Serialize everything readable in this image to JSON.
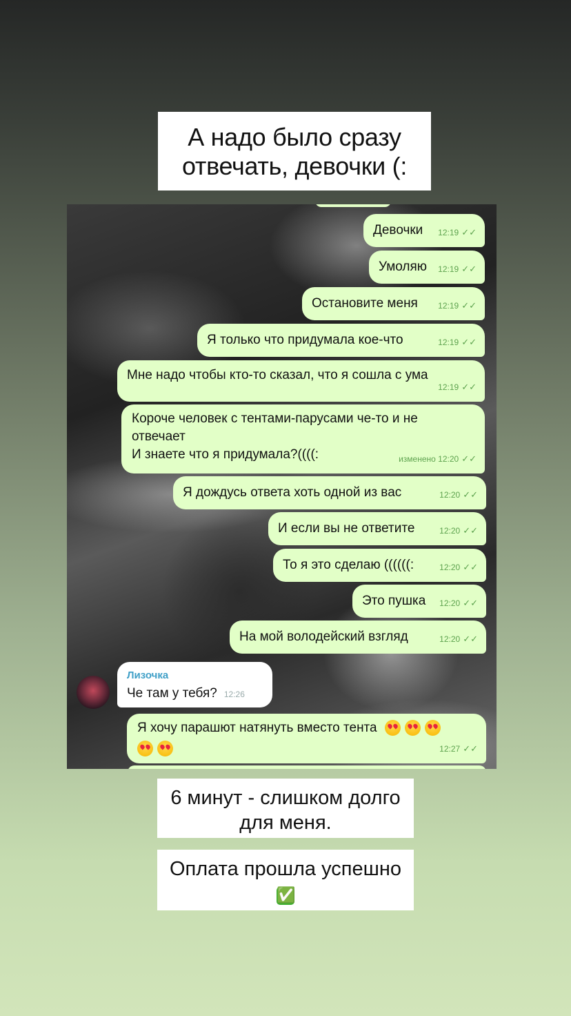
{
  "captions": {
    "top": [
      "А надо было сразу",
      "отвечать, девочки (:"
    ],
    "middle": [
      "6 минут - слишком долго",
      "для меня."
    ],
    "bottom": "Оплата прошла успешно",
    "bottom_emoji": "✅"
  },
  "chat": {
    "outgoing": [
      {
        "text": "Девочки",
        "time": "12:19"
      },
      {
        "text": "Умоляю",
        "time": "12:19"
      },
      {
        "text": "Остановите меня",
        "time": "12:19"
      },
      {
        "text": "Я только что придумала кое-что",
        "time": "12:19"
      },
      {
        "text": "Мне надо чтобы кто-то сказал, что я сошла с ума",
        "time": "12:19"
      },
      {
        "lines": [
          "Короче человек с тентами-парусами  че-то и не",
          "отвечает",
          "И знаете что я придумала?((((:"
        ],
        "edited": "изменено",
        "time": "12:20"
      },
      {
        "text": "Я дождусь ответа хоть одной из вас",
        "time": "12:20"
      },
      {
        "text": "И если вы не ответите",
        "time": "12:20"
      },
      {
        "text": "То я это сделаю ((((((:",
        "time": "12:20"
      },
      {
        "text": "Это пушка",
        "time": "12:20"
      },
      {
        "text": "На мой володейский взгляд",
        "time": "12:20"
      },
      {
        "text": "Я хочу парашют натянуть вместо тента",
        "time": "12:27"
      }
    ],
    "incoming": {
      "sender": "Лизочка",
      "text": "Че там у тебя?",
      "time": "12:26"
    },
    "read_tick": "✓✓",
    "emoji_name": "heart-eyes-emoji"
  },
  "colors": {
    "outgoing_bubble": "#e2ffc7",
    "incoming_bubble": "#ffffff",
    "time_green": "#5ea34f",
    "sender_blue": "#3f9fc7"
  }
}
